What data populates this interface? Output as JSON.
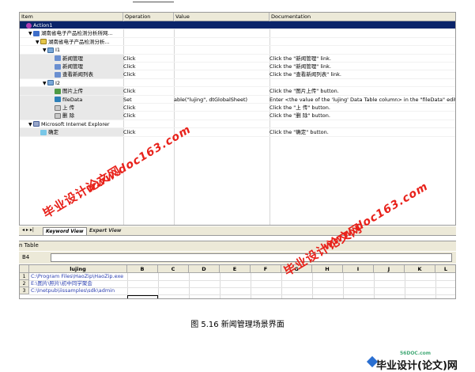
{
  "grid": {
    "columns": [
      "Item",
      "Operation",
      "Value",
      "Documentation"
    ],
    "rows": [
      {
        "indent": 0,
        "twisty": "",
        "icon": "action",
        "item": "Action1",
        "op": "",
        "val": "",
        "doc": "",
        "selected": true
      },
      {
        "indent": 1,
        "twisty": "▼",
        "icon": "browser",
        "item": "湖南省电子产品检测分析所网...",
        "op": "",
        "val": "",
        "doc": ""
      },
      {
        "indent": 2,
        "twisty": "▼",
        "icon": "page",
        "item": "湖南省电子产品检测分析...",
        "op": "",
        "val": "",
        "doc": ""
      },
      {
        "indent": 3,
        "twisty": "▼",
        "icon": "frame",
        "item": "I1",
        "op": "",
        "val": "",
        "doc": ""
      },
      {
        "indent": 4,
        "twisty": "",
        "icon": "link",
        "item": "新闻管理",
        "op": "Click",
        "val": "",
        "doc": "Click the \"新闻管理\" link.",
        "grey": true
      },
      {
        "indent": 4,
        "twisty": "",
        "icon": "link",
        "item": "新闻管理",
        "op": "Click",
        "val": "",
        "doc": "Click the \"新闻管理\" link.",
        "grey": true
      },
      {
        "indent": 4,
        "twisty": "",
        "icon": "link",
        "item": "查看新闻列表",
        "op": "Click",
        "val": "",
        "doc": "Click the \"查看新闻列表\" link.",
        "grey": true
      },
      {
        "indent": 3,
        "twisty": "▼",
        "icon": "frame",
        "item": "I2",
        "op": "",
        "val": "",
        "doc": ""
      },
      {
        "indent": 4,
        "twisty": "",
        "icon": "img",
        "item": "图片上传",
        "op": "Click",
        "val": "",
        "doc": "Click the \"图片上传\" button.",
        "grey": true
      },
      {
        "indent": 4,
        "twisty": "",
        "icon": "edit",
        "item": "fileData",
        "op": "Set",
        "val": "able(\"lujing\", dtGlobalSheet)",
        "doc": "Enter <the value of the 'lujing' Data Table column> in the \"fileData\" edit box.",
        "grey": true
      },
      {
        "indent": 4,
        "twisty": "",
        "icon": "btn",
        "item": "上 传",
        "op": "Click",
        "val": "",
        "doc": "Click the \"上 传\" button.",
        "grey": true
      },
      {
        "indent": 4,
        "twisty": "",
        "icon": "btn",
        "item": "删 除",
        "op": "Click",
        "val": "",
        "doc": "Click the \"删 除\" button.",
        "grey": true
      },
      {
        "indent": 1,
        "twisty": "▼",
        "icon": "dialog",
        "item": "Microsoft Internet Explorer",
        "op": "",
        "val": "",
        "doc": ""
      },
      {
        "indent": 2,
        "twisty": "",
        "icon": "ok",
        "item": "确定",
        "op": "Click",
        "val": "",
        "doc": "Click the \"确定\" button.",
        "grey": true
      }
    ]
  },
  "tabs": {
    "nav": "◂ ▸ ▸|",
    "keyword": "Keyword View",
    "expert": "Expert View"
  },
  "datatable": {
    "title": "n Table",
    "cell_ref": "B4",
    "columns": [
      "lujing",
      "B",
      "C",
      "D",
      "E",
      "F",
      "G",
      "H",
      "I",
      "J",
      "K",
      "L"
    ],
    "row_numbers": [
      "1",
      "2",
      "3"
    ],
    "values": [
      "C:\\Program Files\\HaoZip\\HaoZip.exe",
      "E:\\图片\\照片\\初中同学聚会",
      "C:\\Inetpub\\iissamples\\sdk\\admin"
    ]
  },
  "watermark": {
    "cn": "毕业设计论文网",
    "url": "www.doc163.com"
  },
  "caption": "图 5.16  新闻管理场景界面",
  "logo": {
    "url": "56DOC.com",
    "text": "毕业设计(论文)网"
  }
}
